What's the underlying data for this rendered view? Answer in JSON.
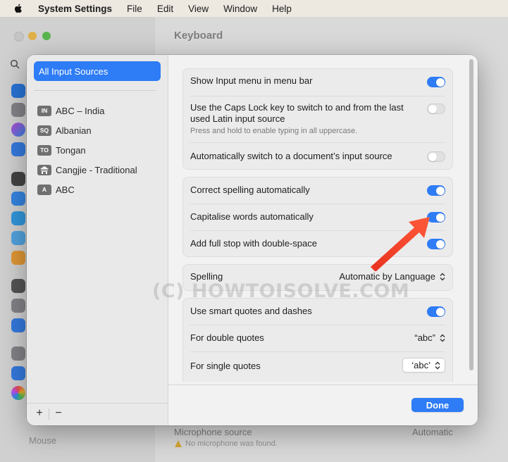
{
  "menubar": {
    "app_name": "System Settings",
    "items": [
      "File",
      "Edit",
      "View",
      "Window",
      "Help"
    ]
  },
  "background_window": {
    "title": "Keyboard",
    "sidebar_mouse_label": "Mouse",
    "microphone_label": "Microphone source",
    "microphone_value": "Automatic",
    "microphone_note": "No microphone was found."
  },
  "sheet": {
    "sidebar": {
      "selected_item": "All Input Sources",
      "sources": [
        {
          "badge": "IN",
          "label": "ABC – India"
        },
        {
          "badge": "SQ",
          "label": "Albanian"
        },
        {
          "badge": "TO",
          "label": "Tongan"
        },
        {
          "badge": "",
          "label": "Cangjie - Traditional"
        },
        {
          "badge": "A",
          "label": "ABC"
        }
      ],
      "add_label": "+",
      "remove_label": "−"
    },
    "group1": {
      "show_input_menu": {
        "label": "Show Input menu in menu bar",
        "on": true
      },
      "caps_lock": {
        "label": "Use the Caps Lock key to switch to and from the last used Latin input source",
        "sublabel": "Press and hold to enable typing in all uppercase.",
        "on": false
      },
      "auto_switch": {
        "label": "Automatically switch to a document’s input source",
        "on": false
      }
    },
    "group2": {
      "correct_spelling": {
        "label": "Correct spelling automatically",
        "on": true
      },
      "capitalise_words": {
        "label": "Capitalise words automatically",
        "on": true
      },
      "full_stop": {
        "label": "Add full stop with double-space",
        "on": true
      }
    },
    "spelling": {
      "label": "Spelling",
      "value": "Automatic by Language"
    },
    "group4": {
      "smart_quotes": {
        "label": "Use smart quotes and dashes",
        "on": true
      },
      "double_quotes": {
        "label": "For double quotes",
        "value": "“abc”"
      },
      "single_quotes": {
        "label": "For single quotes",
        "value": "‘abc’"
      }
    },
    "done_label": "Done"
  },
  "watermark": "(C) HOWTOISOLVE.COM",
  "colors": {
    "accent": "#2e7cf6",
    "annotation_arrow": "#f0402a"
  }
}
